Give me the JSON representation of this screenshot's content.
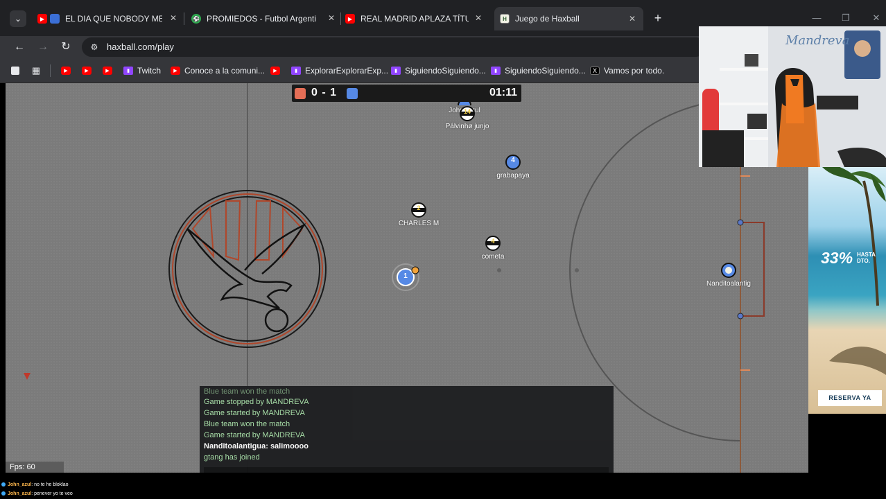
{
  "browser": {
    "tabs": [
      {
        "label": "EL DIA QUE NOBODY METI",
        "icon": "youtube-icon"
      },
      {
        "label": "PROMIEDOS - Futbol Argentino",
        "icon": "soccer-ball-icon"
      },
      {
        "label": "REAL MADRID APLAZA TÍTULO",
        "icon": "youtube-icon"
      },
      {
        "label": "Juego de Haxball",
        "icon": "haxball-icon",
        "active": true
      }
    ],
    "url": "haxball.com/play",
    "bookmarks": [
      {
        "label": "",
        "icon": "youtube-icon"
      },
      {
        "label": "",
        "icon": "youtube-icon"
      },
      {
        "label": "",
        "icon": "youtube-icon"
      },
      {
        "label": "Twitch",
        "icon": "twitch-icon"
      },
      {
        "label": "Conoce a la comuni...",
        "icon": "youtube-icon"
      },
      {
        "label": "",
        "icon": "youtube-icon"
      },
      {
        "label": "ExplorarExplorarExp...",
        "icon": "twitch-icon"
      },
      {
        "label": "SiguiendoSiguiendo...",
        "icon": "twitch-icon"
      },
      {
        "label": "SiguiendoSiguiendo...",
        "icon": "twitch-icon"
      },
      {
        "label": "Vamos por todo.",
        "icon": "x-icon"
      }
    ]
  },
  "game": {
    "score": "0 - 1",
    "time": "01:11",
    "colors": {
      "red": "#e56e56",
      "blue": "#5689e5",
      "field": "#7b7b7b"
    },
    "players": [
      {
        "name": "John_azul",
        "number": "",
        "team": "blue"
      },
      {
        "name": "Pálvinhø junjo",
        "number": "14",
        "team": "red"
      },
      {
        "name": "grabapaya",
        "number": "4",
        "team": "blue"
      },
      {
        "name": "CHARLES M",
        "number": "2",
        "team": "red"
      },
      {
        "name": "cometa",
        "number": "4",
        "team": "red"
      },
      {
        "name": "",
        "number": "1",
        "team": "blue"
      },
      {
        "name": "Nanditoalantig",
        "number": "",
        "team": "blue"
      }
    ],
    "chat": [
      {
        "text": "Blue team won the match",
        "type": "system"
      },
      {
        "text": "Game stopped by MANDREVA",
        "type": "system"
      },
      {
        "text": "Game started by MANDREVA",
        "type": "system"
      },
      {
        "text": "Blue team won the match",
        "type": "system"
      },
      {
        "text": "Game started by MANDREVA",
        "type": "system"
      },
      {
        "text": "Nanditoalantigua: salimoooo",
        "type": "player"
      },
      {
        "text": "gtang has joined",
        "type": "system"
      }
    ],
    "fps": "Fps: 60"
  },
  "stream": {
    "webcam_sign": "Mandreva",
    "ad": {
      "percent": "33%",
      "hasta": "HASTA",
      "dto": "DTO.",
      "cta": "RESERVA YA"
    },
    "twitch_chat": [
      {
        "user": "John_azul",
        "text": ": no te he bloklao"
      },
      {
        "user": "John_azul",
        "text": ": penever yo te veo"
      }
    ]
  }
}
